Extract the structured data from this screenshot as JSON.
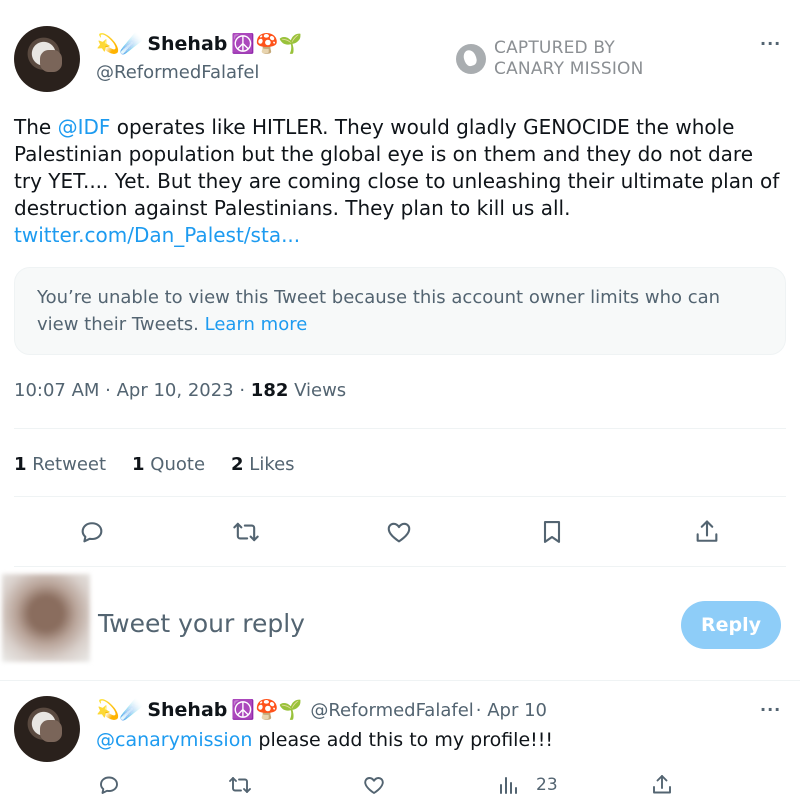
{
  "tweet": {
    "emoji_prefix": "💫☄️",
    "display_name": "Shehab",
    "emoji_suffix": "☮️🍄🌱",
    "handle": "@ReformedFalafel",
    "text_before_mention": "The ",
    "mention": "@IDF",
    "text_after_mention": " operates like HITLER. They would gladly GENOCIDE the whole Palestinian population but the global eye is on them and they do not dare try YET.... Yet. But they are coming close to unleashing their ultimate plan of destruction against Palestinians. They plan to kill us all.",
    "link": "twitter.com/Dan_Palest/sta...",
    "notice_text": "You’re unable to view this Tweet because this account owner limits who can view their Tweets.",
    "notice_link": "Learn more",
    "time": "10:07 AM · Apr 10, 2023 · ",
    "views_count": "182",
    "views_label": " Views",
    "more": "···"
  },
  "watermark": {
    "line1": "CAPTURED BY",
    "line2": "CANARY MISSION"
  },
  "stats": {
    "retweets_count": "1",
    "retweets_label": "Retweet",
    "quotes_count": "1",
    "quotes_label": "Quote",
    "likes_count": "2",
    "likes_label": "Likes"
  },
  "compose": {
    "placeholder": "Tweet your reply",
    "button": "Reply"
  },
  "reply": {
    "emoji_prefix": "💫☄️",
    "display_name": "Shehab",
    "emoji_suffix": "☮️🍄🌱",
    "handle": "@ReformedFalafel",
    "date": " · Apr 10",
    "mention": "@canarymission",
    "text": " please add this to my profile!!!",
    "views_count": "23",
    "more": "···"
  },
  "colors": {
    "accent": "#1d9bf0",
    "reply_button": "#8ecdf8",
    "secondary_text": "#536471"
  },
  "icons": [
    "reply-icon",
    "retweet-icon",
    "like-icon",
    "bookmark-icon",
    "share-icon",
    "views-icon",
    "more-icon",
    "canary-logo-icon"
  ]
}
